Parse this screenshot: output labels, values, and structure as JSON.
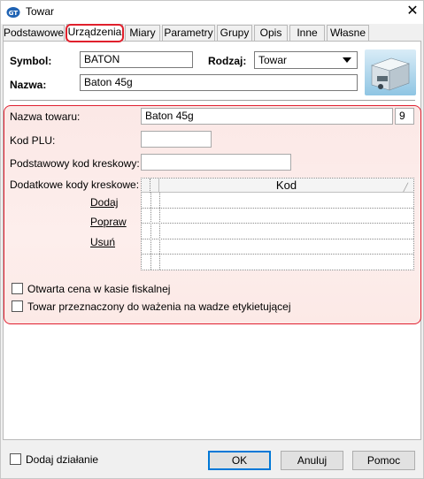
{
  "window": {
    "title": "Towar",
    "close_label": "✕"
  },
  "tabs": [
    {
      "label": "Podstawowe"
    },
    {
      "label": "Urządzenia"
    },
    {
      "label": "Miary"
    },
    {
      "label": "Parametry"
    },
    {
      "label": "Grupy"
    },
    {
      "label": "Opis"
    },
    {
      "label": "Inne"
    },
    {
      "label": "Własne"
    }
  ],
  "active_tab": "Urządzenia",
  "header": {
    "symbol_label": "Symbol:",
    "symbol_value": "BATON",
    "rodzaj_label": "Rodzaj:",
    "rodzaj_value": "Towar",
    "nazwa_label": "Nazwa:",
    "nazwa_value": "Baton 45g"
  },
  "device": {
    "nazwa_towaru_label": "Nazwa towaru:",
    "nazwa_towaru_value": "Baton 45g",
    "nazwa_towaru_count": "9",
    "kod_plu_label": "Kod PLU:",
    "kod_plu_value": "",
    "podstawowy_kod_label": "Podstawowy kod kreskowy:",
    "podstawowy_kod_value": "",
    "dodatkowe_kody_label": "Dodatkowe kody kreskowe:",
    "grid_column": "Kod",
    "actions": {
      "add": "Dodaj",
      "edit": "Popraw",
      "delete": "Usuń"
    },
    "checkbox_open_price": "Otwarta cena w kasie fiskalnej",
    "checkbox_weighing": "Towar przeznaczony do ważenia na wadze etykietującej"
  },
  "footer": {
    "add_action_label": "Dodaj działanie",
    "ok_label": "OK",
    "cancel_label": "Anuluj",
    "help_label": "Pomoc"
  },
  "colors": {
    "highlight": "#e0202c",
    "highlight_fill": "#fbe8e6",
    "default_button_border": "#0078d7"
  }
}
